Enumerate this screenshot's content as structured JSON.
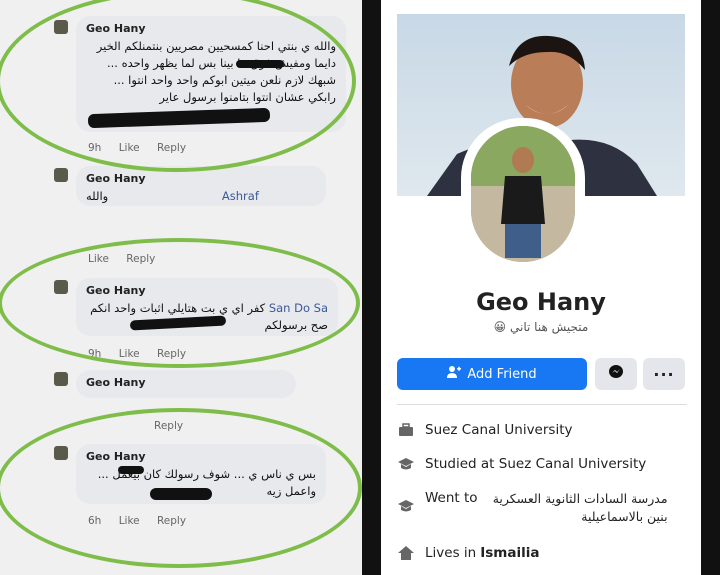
{
  "comments": [
    {
      "name": "Geo Hany",
      "text": "والله ي بنتي احنا كمسحيين مصريين بنتمنلكم الخير دايما ومفيش فرق ما بينا بس لما يظهر واحده ... شبهك لازم نلعن ميتين ابوكم واحد واحد انتوا ... رابكي عشان انتوا بتامنوا برسول عاير",
      "time": "9h",
      "like": "Like",
      "reply": "Reply"
    },
    {
      "name": "Geo Hany",
      "mention": "Ashraf",
      "text": "والله",
      "time": "",
      "like": "Like",
      "reply": "Reply"
    },
    {
      "name": "Geo Hany",
      "mention": "San Do Sa",
      "text": "كفر اي ي بت هتايلي اثبات واحد انكم صح برسولكم",
      "time": "9h",
      "like": "Like",
      "reply": "Reply"
    },
    {
      "name": "Geo Hany",
      "text": "",
      "time": "",
      "like": "",
      "reply": "Reply"
    },
    {
      "name": "Geo Hany",
      "text": "بس ي ناس ي ... شوف رسولك كان بيعمل ... واعمل زيه",
      "time": "6h",
      "like": "Like",
      "reply": "Reply"
    }
  ],
  "profile": {
    "name": "Geo Hany",
    "bio": "متجيش هنا تاني",
    "bio_emoji": "😀",
    "add_friend": "Add Friend",
    "messenger_icon": "messenger-icon",
    "more_icon": "more-icon",
    "info": [
      {
        "icon": "work-icon",
        "text": "Suez Canal University"
      },
      {
        "icon": "education-icon",
        "text": "Studied at Suez Canal University"
      },
      {
        "icon": "education-icon",
        "text": "Went to",
        "extra": "مدرسة السادات الثانوية العسكرية بنين بالاسماعيلية"
      },
      {
        "icon": "home-icon",
        "text": "Lives in",
        "place": "Ismailia"
      }
    ]
  },
  "colors": {
    "accent": "#1877f2",
    "highlight": "#7fbd4a"
  }
}
